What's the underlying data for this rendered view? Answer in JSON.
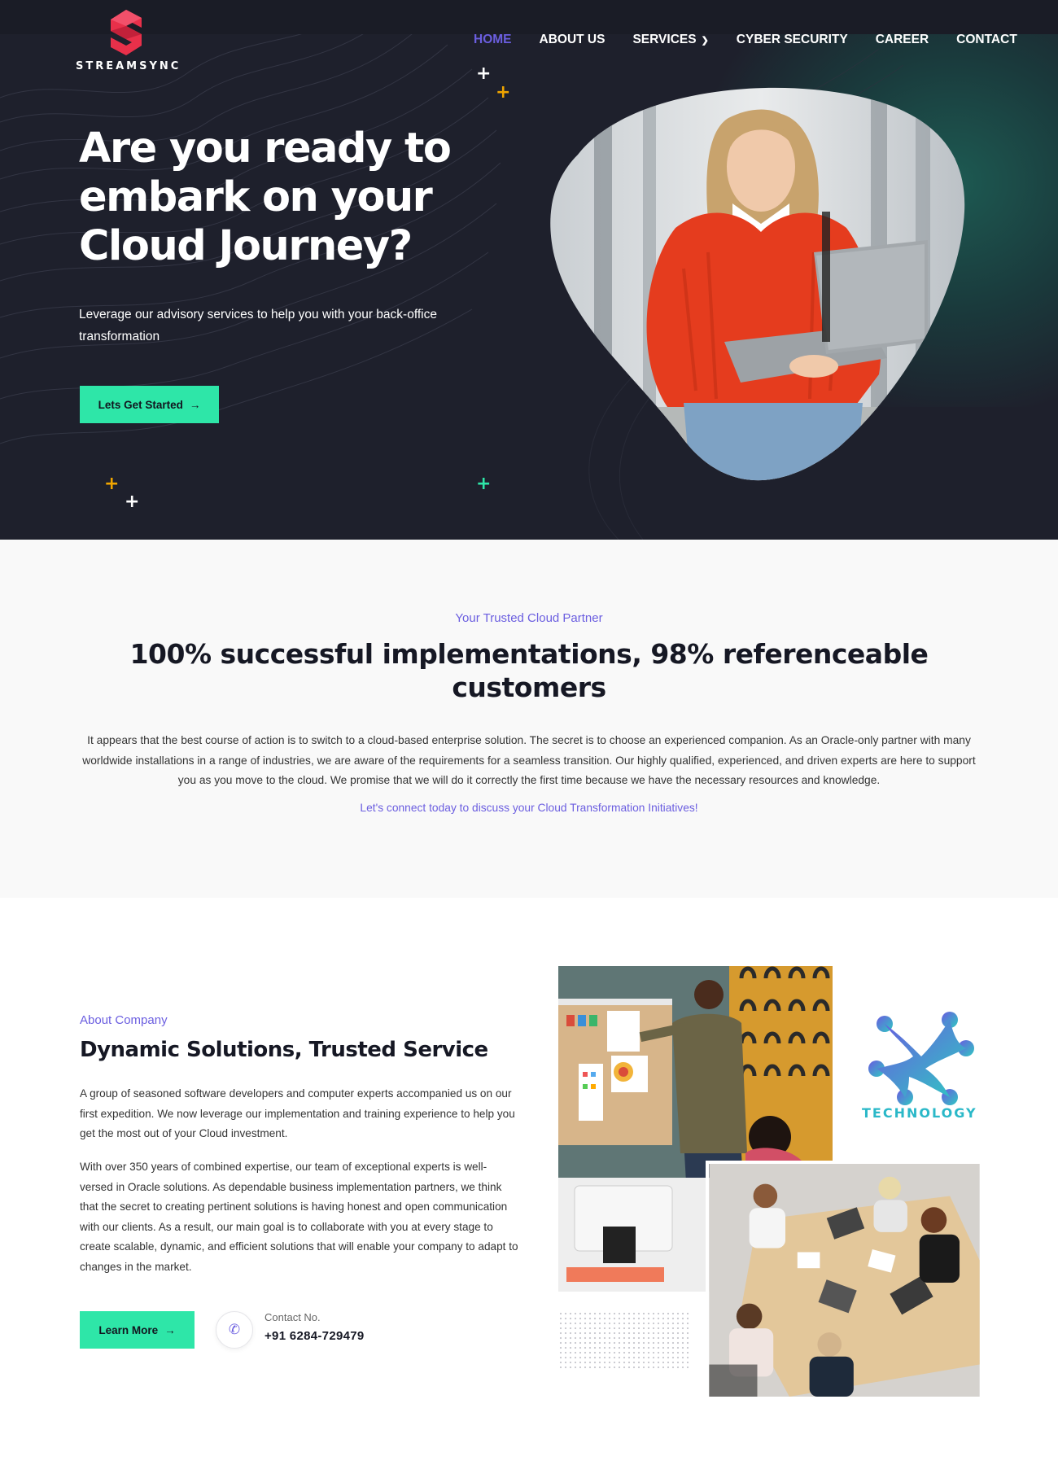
{
  "brand": {
    "name": "STREAMSYNC"
  },
  "nav": {
    "items": [
      {
        "label": "HOME",
        "active": true
      },
      {
        "label": "ABOUT US",
        "active": false
      },
      {
        "label": "SERVICES",
        "active": false,
        "has_dropdown": true
      },
      {
        "label": "CYBER SECURITY",
        "active": false
      },
      {
        "label": "CAREER",
        "active": false
      },
      {
        "label": "CONTACT",
        "active": false
      }
    ]
  },
  "hero": {
    "title": "Are you ready to embark on your Cloud Journey?",
    "subtitle": "Leverage our advisory services to help you with your back-office transformation",
    "cta_label": "Lets Get Started",
    "image_icon": "woman-with-laptop-photo"
  },
  "partner": {
    "eyebrow": "Your Trusted Cloud Partner",
    "title": "100% successful implementations, 98% referenceable customers",
    "body": "It appears that the best course of action is to switch to a cloud-based enterprise solution. The secret is to choose an experienced companion. As an Oracle-only partner with many worldwide installations in a range of industries, we are aware of the requirements for a seamless transition. Our highly qualified, experienced, and driven experts are here to support you as you move to the cloud. We promise that we will do it correctly the first time because we have the necessary resources and knowledge.",
    "link_text": "Let's connect today to discuss your Cloud Transformation Initiatives!"
  },
  "about": {
    "eyebrow": "About Company",
    "title": "Dynamic Solutions, Trusted Service",
    "paragraph1": "A group of seasoned software developers and computer experts accompanied us on our first expedition. We now leverage our implementation and training experience to help you get the most out of your Cloud investment.",
    "paragraph2": "With over 350 years of combined expertise, our team of exceptional experts is well-versed in Oracle solutions. As dependable business implementation partners, we think that the secret to creating pertinent solutions is having honest and open communication with our clients. As a result, our main goal is to collaborate with you at every stage to create scalable, dynamic, and efficient solutions that will enable your company to adapt to changes in the market.",
    "cta_label": "Learn More",
    "contact_label": "Contact No.",
    "contact_number": "+91 6284-729479",
    "partner_logo_text": "TECHNOLOGY"
  },
  "colors": {
    "accent_purple": "#6b5ee0",
    "accent_green": "#2ee6a8",
    "hero_bg": "#1e202c",
    "brand_red": "#e8304a"
  }
}
